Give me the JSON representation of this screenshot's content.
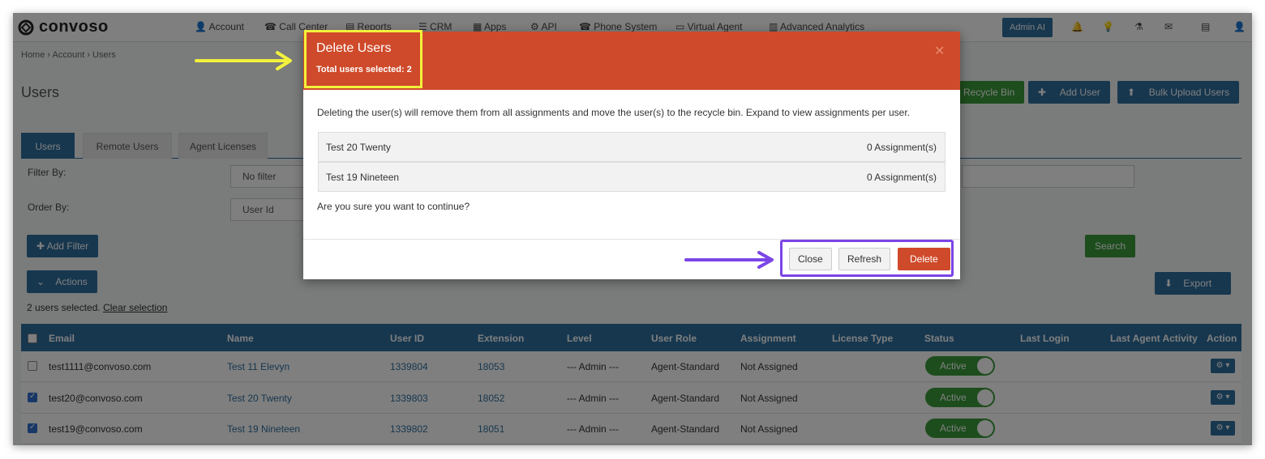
{
  "brand": {
    "name": "convoso"
  },
  "topnav": {
    "items": [
      "Account",
      "Call Center",
      "Reports",
      "CRM",
      "Apps",
      "API",
      "Phone System",
      "Virtual Agent",
      "Advanced Analytics"
    ],
    "admin_ai": "Admin AI"
  },
  "breadcrumb": [
    "Home",
    "Account",
    "Users"
  ],
  "page_title": "Users",
  "header_buttons": {
    "recycle_bin": "Recycle Bin",
    "add_user": "Add User",
    "bulk_upload": "Bulk Upload Users"
  },
  "tabs": [
    "Users",
    "Remote Users",
    "Agent Licenses"
  ],
  "filters": {
    "filter_label": "Filter By:",
    "filter_value": "No filter",
    "order_label": "Order By:",
    "order_value": "User Id",
    "add_filter": "Add Filter",
    "search": "Search",
    "actions": "Actions",
    "export": "Export"
  },
  "selection": {
    "text": "2 users selected.",
    "clear": "Clear selection"
  },
  "table": {
    "columns": [
      "Email",
      "Name",
      "User ID",
      "Extension",
      "Level",
      "User Role",
      "Assignment",
      "License Type",
      "Status",
      "Last Login",
      "Last Agent Activity",
      "Action"
    ],
    "rows": [
      {
        "email": "test1111@convoso.com",
        "name": "Test 11 Elevyn",
        "user_id": "1339804",
        "extension": "18053",
        "level": "--- Admin ---",
        "role": "Agent-Standard",
        "assignment": "Not Assigned",
        "status": "Active",
        "checked": false
      },
      {
        "email": "test20@convoso.com",
        "name": "Test 20 Twenty",
        "user_id": "1339803",
        "extension": "18052",
        "level": "--- Admin ---",
        "role": "Agent-Standard",
        "assignment": "Not Assigned",
        "status": "Active",
        "checked": true
      },
      {
        "email": "test19@convoso.com",
        "name": "Test 19 Nineteen",
        "user_id": "1339802",
        "extension": "18051",
        "level": "--- Admin ---",
        "role": "Agent-Standard",
        "assignment": "Not Assigned",
        "status": "Active",
        "checked": true
      }
    ]
  },
  "modal": {
    "title": "Delete Users",
    "subtitle": "Total users selected: 2",
    "description": "Deleting the user(s) will remove them from all assignments and move the user(s) to the recycle bin. Expand to view assignments per user.",
    "users": [
      {
        "name": "Test 20 Twenty",
        "assignments": "0 Assignment(s)"
      },
      {
        "name": "Test 19 Nineteen",
        "assignments": "0 Assignment(s)"
      }
    ],
    "confirm": "Are you sure you want to continue?",
    "buttons": {
      "close": "Close",
      "refresh": "Refresh",
      "delete": "Delete"
    }
  },
  "colors": {
    "primary": "#2f6f9f",
    "danger": "#cf4a2a",
    "success": "#3a9a3a",
    "highlight_yellow": "#f2f23c",
    "highlight_purple": "#7b45e6"
  }
}
